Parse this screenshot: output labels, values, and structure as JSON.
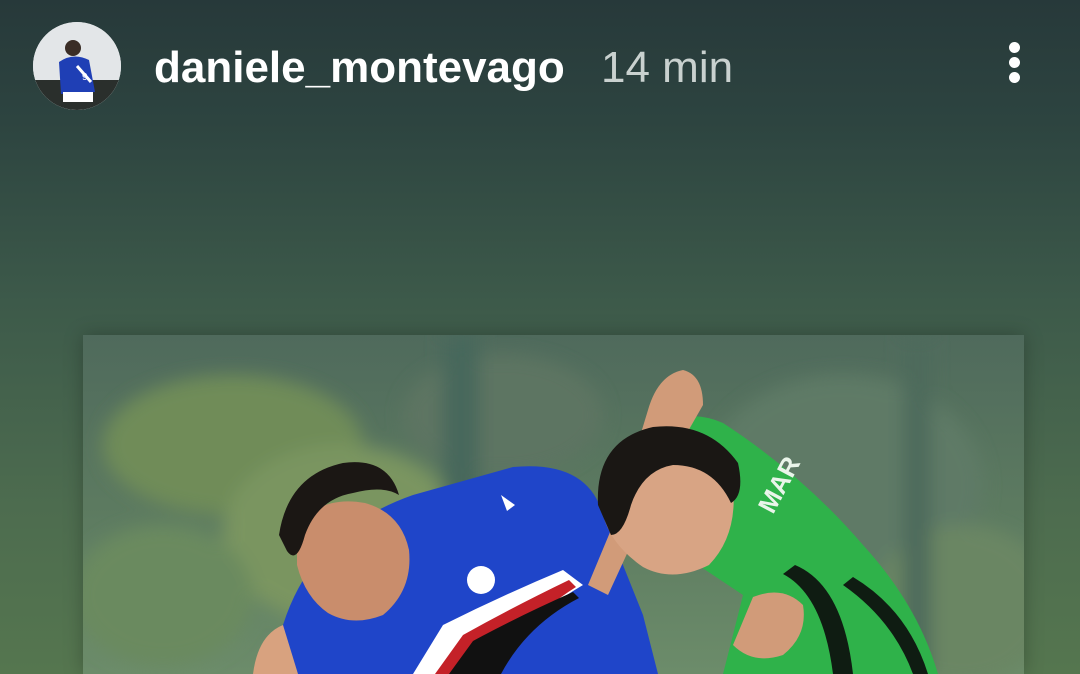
{
  "header": {
    "avatar_icon": "avatar-player-sampdoria",
    "username": "daniele_montevago",
    "timestamp": "14 min",
    "more_icon": "more-vertical-icon"
  },
  "post": {
    "media_icon": "football-match-photo"
  },
  "colors": {
    "background_top": "#27393a",
    "background_bottom": "#55764f",
    "username": "#ffffff",
    "timestamp": "#c9d1cf",
    "sampdoria_blue": "#1f45c9",
    "sassuolo_green": "#2fb24a"
  }
}
